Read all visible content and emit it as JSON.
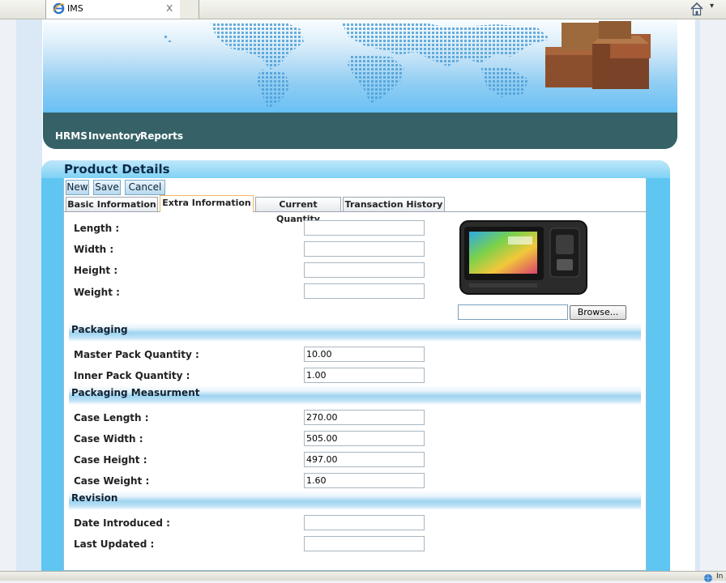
{
  "browser": {
    "tab_title": "IMS",
    "tab_close": "x",
    "zone_text": "In"
  },
  "nav": {
    "items": [
      "HRMS",
      "Inventory",
      "Reports"
    ]
  },
  "panel": {
    "title": "Product Details"
  },
  "toolbar": {
    "new_label": "New",
    "save_label": "Save",
    "cancel_label": "Cancel"
  },
  "tabs": [
    {
      "label": "Basic Information",
      "active": false
    },
    {
      "label": "Extra Information",
      "active": true
    },
    {
      "label": "Current Quantity",
      "active": false
    },
    {
      "label": "Transaction History",
      "active": false
    }
  ],
  "dimensions": {
    "length_label": "Length :",
    "length_value": "",
    "width_label": "Width :",
    "width_value": "",
    "height_label": "Height :",
    "height_value": "",
    "weight_label": "Weight :",
    "weight_value": ""
  },
  "image_upload": {
    "browse_label": "Browse...",
    "file_value": ""
  },
  "packaging": {
    "header": "Packaging",
    "master_label": "Master Pack Quantity :",
    "master_value": "10.00",
    "inner_label": "Inner Pack Quantity :",
    "inner_value": "1.00"
  },
  "measurement": {
    "header": "Packaging Measurment",
    "case_length_label": "Case Length :",
    "case_length_value": "270.00",
    "case_width_label": "Case Width :",
    "case_width_value": "505.00",
    "case_height_label": "Case Height :",
    "case_height_value": "497.00",
    "case_weight_label": "Case Weight :",
    "case_weight_value": "1.60"
  },
  "revision": {
    "header": "Revision",
    "date_introduced_label": "Date Introduced :",
    "date_introduced_value": "",
    "last_updated_label": "Last Updated :",
    "last_updated_value": ""
  },
  "colors": {
    "nav_bar": "#366267",
    "panel_accent": "#5fc6f2",
    "active_tab_border": "#f0b860"
  }
}
